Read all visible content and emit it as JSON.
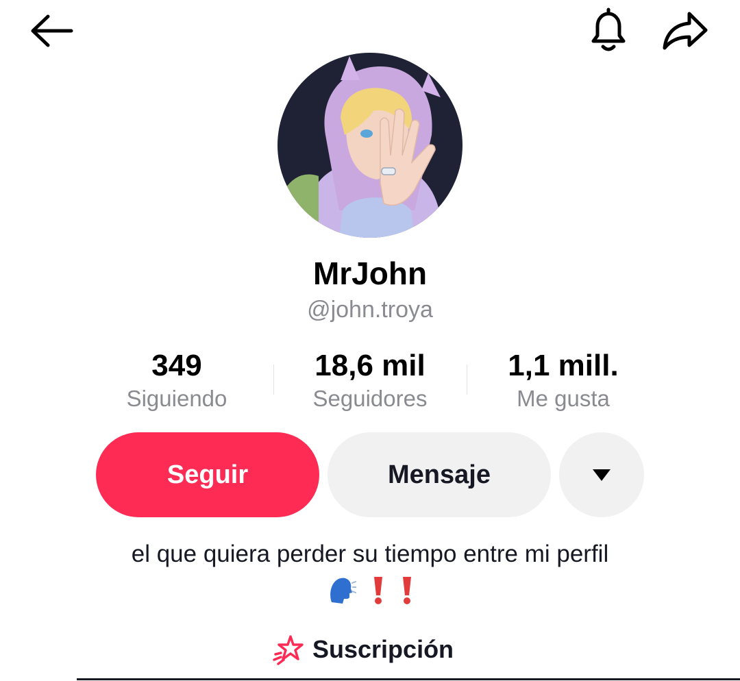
{
  "header": {
    "back_icon": "arrow-left-icon",
    "notification_icon": "bell-icon",
    "share_icon": "share-arrow-icon"
  },
  "profile": {
    "avatar_icon": "anime-avatar-image",
    "display_name": "MrJohn",
    "username": "@john.troya"
  },
  "stats": [
    {
      "value": "349",
      "label": "Siguiendo"
    },
    {
      "value": "18,6 mil",
      "label": "Seguidores"
    },
    {
      "value": "1,1 mill.",
      "label": "Me gusta"
    }
  ],
  "actions": {
    "follow_label": "Seguir",
    "message_label": "Mensaje",
    "more_icon": "triangle-down-icon"
  },
  "bio": {
    "text": "el que quiera perder su tiempo entre mi perfil",
    "emojis": [
      "🗣️",
      "❗",
      "❗"
    ]
  },
  "tabs": {
    "subscription_icon": "star-icon",
    "subscription_label": "Suscripción"
  },
  "colors": {
    "accent": "#fe2c55",
    "secondary_button": "#f1f1f2",
    "muted_text": "#8a8b91",
    "primary_text": "#161823"
  }
}
